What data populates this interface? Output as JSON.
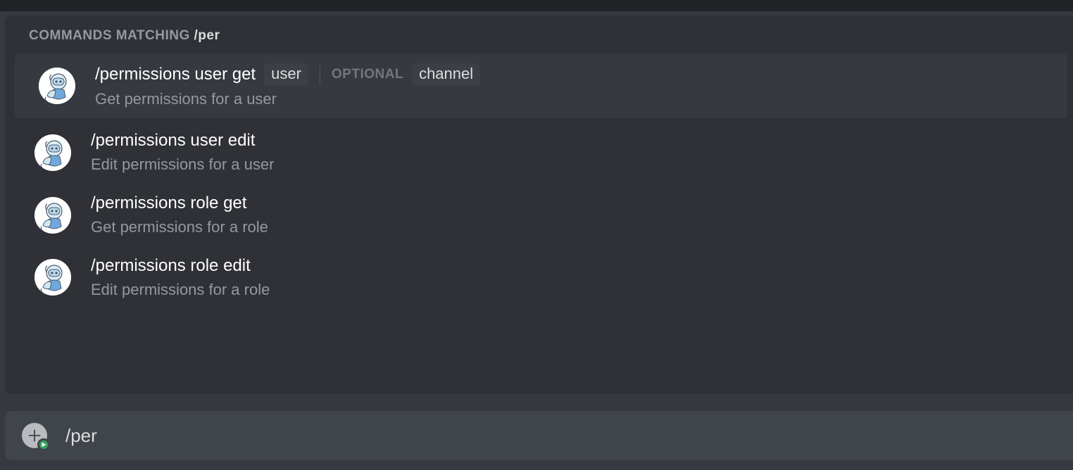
{
  "header": {
    "prefix": "COMMANDS MATCHING ",
    "query": "/per"
  },
  "optional_label": "OPTIONAL",
  "commands": [
    {
      "name": "/permissions user get",
      "desc": "Get permissions for a user",
      "params": [
        "user"
      ],
      "optional_params": [
        "channel"
      ],
      "selected": true
    },
    {
      "name": "/permissions user edit",
      "desc": "Edit permissions for a user",
      "params": [],
      "optional_params": [],
      "selected": false
    },
    {
      "name": "/permissions role get",
      "desc": "Get permissions for a role",
      "params": [],
      "optional_params": [],
      "selected": false
    },
    {
      "name": "/permissions role edit",
      "desc": "Edit permissions for a role",
      "params": [],
      "optional_params": [],
      "selected": false
    }
  ],
  "input": {
    "value": "/per"
  }
}
